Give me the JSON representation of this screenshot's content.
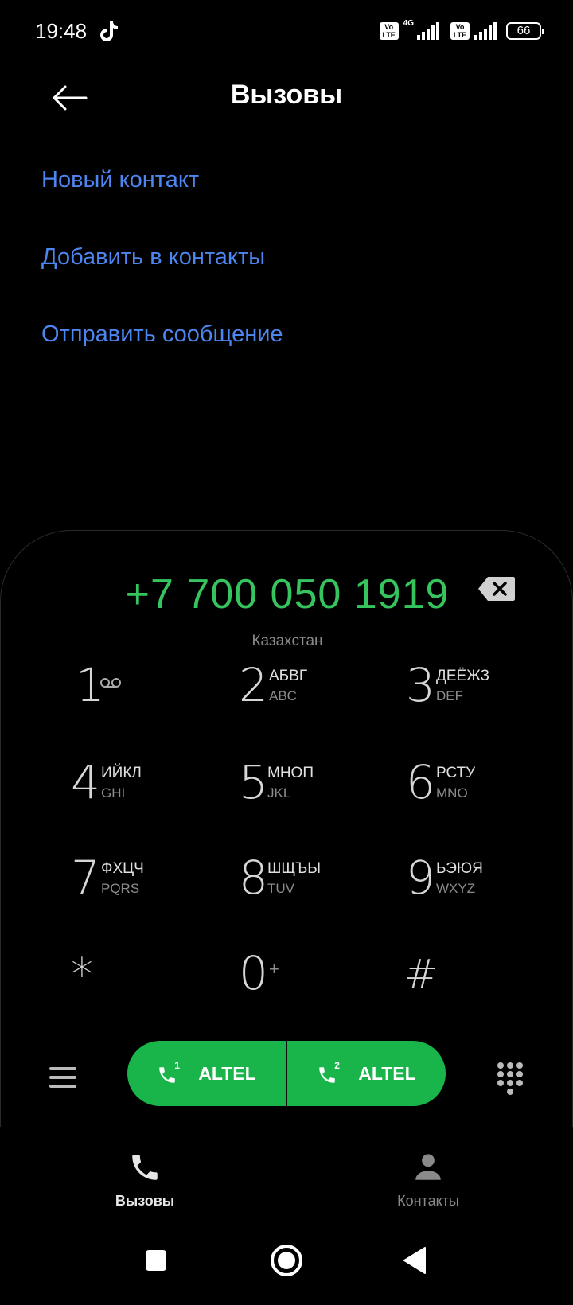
{
  "status_bar": {
    "time": "19:48",
    "network": "4G",
    "volte_label": "Vo\nLTE",
    "battery": "66"
  },
  "header": {
    "title": "Вызовы"
  },
  "actions": {
    "new_contact": "Новый контакт",
    "add_to_contacts": "Добавить в контакты",
    "send_message": "Отправить сообщение"
  },
  "dialer": {
    "number": "+7 700 050 1919",
    "region": "Казахстан",
    "keys": [
      {
        "digit": "1",
        "l1": "",
        "l2": ""
      },
      {
        "digit": "2",
        "l1": "АБВГ",
        "l2": "ABC"
      },
      {
        "digit": "3",
        "l1": "ДЕЁЖЗ",
        "l2": "DEF"
      },
      {
        "digit": "4",
        "l1": "ИЙКЛ",
        "l2": "GHI"
      },
      {
        "digit": "5",
        "l1": "МНОП",
        "l2": "JKL"
      },
      {
        "digit": "6",
        "l1": "РСТУ",
        "l2": "MNO"
      },
      {
        "digit": "7",
        "l1": "ФХЦЧ",
        "l2": "PQRS"
      },
      {
        "digit": "8",
        "l1": "ШЩЪЫ",
        "l2": "TUV"
      },
      {
        "digit": "9",
        "l1": "ЬЭЮЯ",
        "l2": "WXYZ"
      },
      {
        "digit": "*",
        "l1": "",
        "l2": ""
      },
      {
        "digit": "0",
        "l1": "+",
        "l2": ""
      },
      {
        "digit": "#",
        "l1": "",
        "l2": ""
      }
    ]
  },
  "call_buttons": {
    "sim1": {
      "label": "ALTEL",
      "sim": "1"
    },
    "sim2": {
      "label": "ALTEL",
      "sim": "2"
    }
  },
  "bottom_nav": {
    "calls": "Вызовы",
    "contacts": "Контакты"
  },
  "colors": {
    "accent_blue": "#4d86f0",
    "number_green": "#35c45e",
    "call_green": "#1ab54a"
  }
}
